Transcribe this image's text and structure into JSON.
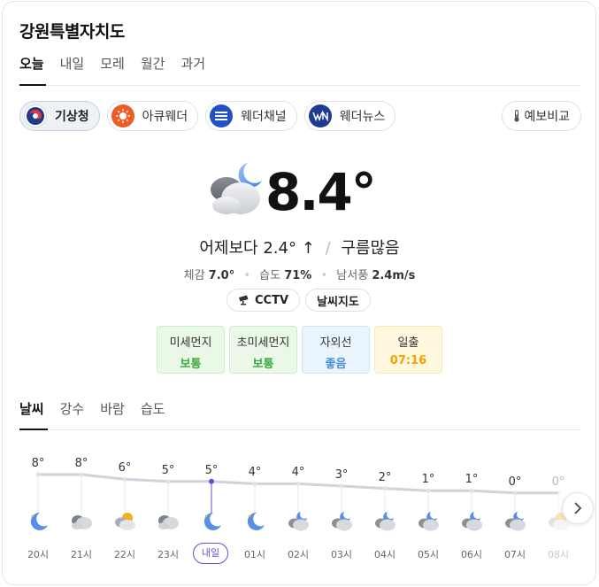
{
  "title": "강원특별자치도",
  "tabs": [
    {
      "label": "오늘",
      "active": true
    },
    {
      "label": "내일"
    },
    {
      "label": "모레"
    },
    {
      "label": "월간"
    },
    {
      "label": "과거"
    }
  ],
  "sources": [
    {
      "label": "기상청",
      "icon": "kma-logo-icon",
      "active": true
    },
    {
      "label": "아큐웨더",
      "icon": "accuweather-logo-icon"
    },
    {
      "label": "웨더채널",
      "icon": "weather-channel-logo-icon"
    },
    {
      "label": "웨더뉴스",
      "icon": "weathernews-logo-icon"
    }
  ],
  "compare_label": "예보비교",
  "current": {
    "temp": "8.4°",
    "compare_text": "어제보다",
    "delta": "2.4°",
    "delta_arrow": "↑",
    "condition": "구름많음",
    "feels_label": "체감",
    "feels_value": "7.0°",
    "humidity_label": "습도",
    "humidity_value": "71%",
    "wind_label": "남서풍",
    "wind_value": "2.4m/s"
  },
  "chips": [
    {
      "label": "CCTV",
      "icon": "cctv-icon"
    },
    {
      "label": "날씨지도"
    }
  ],
  "air": [
    {
      "label": "미세먼지",
      "value": "보통",
      "color": "#3aa83a"
    },
    {
      "label": "초미세먼지",
      "value": "보통",
      "color": "#3aa83a"
    },
    {
      "label": "자외선",
      "value": "좋음",
      "color": "#4a90d9"
    },
    {
      "label": "일출",
      "value": "07:16",
      "color": "#f2a100"
    }
  ],
  "tabs2": [
    {
      "label": "날씨",
      "active": true
    },
    {
      "label": "강수"
    },
    {
      "label": "바람"
    },
    {
      "label": "습도"
    }
  ],
  "hourly": [
    {
      "time": "20시",
      "temp": "8°",
      "t": 8,
      "icon": "moon"
    },
    {
      "time": "21시",
      "temp": "8°",
      "t": 8,
      "icon": "cloud-dark"
    },
    {
      "time": "22시",
      "temp": "6°",
      "t": 6,
      "icon": "cloud-sun"
    },
    {
      "time": "23시",
      "temp": "5°",
      "t": 5,
      "icon": "cloud-dark"
    },
    {
      "time": "내일",
      "temp": "5°",
      "t": 5,
      "icon": "moon",
      "now": true
    },
    {
      "time": "01시",
      "temp": "4°",
      "t": 4,
      "icon": "moon"
    },
    {
      "time": "02시",
      "temp": "4°",
      "t": 4,
      "icon": "cloud-moon"
    },
    {
      "time": "03시",
      "temp": "3°",
      "t": 3,
      "icon": "cloud-moon"
    },
    {
      "time": "04시",
      "temp": "2°",
      "t": 2,
      "icon": "cloud-moon"
    },
    {
      "time": "05시",
      "temp": "1°",
      "t": 1,
      "icon": "cloud-moon"
    },
    {
      "time": "06시",
      "temp": "1°",
      "t": 1,
      "icon": "cloud-moon"
    },
    {
      "time": "07시",
      "temp": "0°",
      "t": 0,
      "icon": "cloud-moon"
    },
    {
      "time": "08시",
      "temp": "0°",
      "t": 0,
      "icon": "cloud-sun",
      "faded": true
    }
  ],
  "colors": {
    "accent": "#6a4ad8",
    "line": "#cfd3db"
  }
}
